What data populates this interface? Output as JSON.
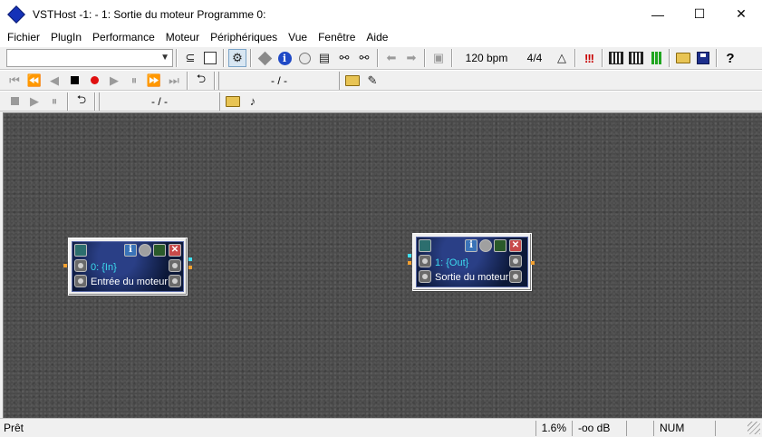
{
  "window": {
    "title": "VSTHost -1:  - 1: Sortie du moteur Programme 0:",
    "minimize_symbol": "—",
    "maximize_symbol": "☐",
    "close_symbol": "✕"
  },
  "menu": {
    "items": [
      "Fichier",
      "PlugIn",
      "Performance",
      "Moteur",
      "Périphériques",
      "Vue",
      "Fenêtre",
      "Aide"
    ]
  },
  "toolbar": {
    "plugin_select_value": "",
    "bpm": "120 bpm",
    "time_signature": "4/4",
    "icons": [
      "chain-icon",
      "patch-icon",
      "engine-icon",
      "diamond-icon",
      "info-icon",
      "bypass-icon",
      "program-icon",
      "chain-link-icon",
      "chain-link2-icon",
      "back-arrow-icon",
      "forward-arrow-icon",
      "duplicate-icon",
      "metronome-icon",
      "midi-panic-icon",
      "keyboard-icon",
      "midi-icon",
      "vu-meter-icon",
      "open-folder-icon",
      "save-icon",
      "help-icon"
    ]
  },
  "transport": {
    "position": "- / -",
    "position2": "- / -"
  },
  "plugins": [
    {
      "id": "0: {In}",
      "label": "Entrée du moteur"
    },
    {
      "id": "1: {Out}",
      "label": "Sortie du moteur"
    }
  ],
  "status": {
    "ready": "Prêt",
    "cpu": "1.6%",
    "level": "-oo dB",
    "num": "NUM"
  },
  "colors": {
    "canvas": "#4a4a4a",
    "plugin_name": "#3cdcf0",
    "pin_orange": "#f2a030",
    "pin_cyan": "#40e0f0",
    "brand_blue": "#1532b8"
  }
}
